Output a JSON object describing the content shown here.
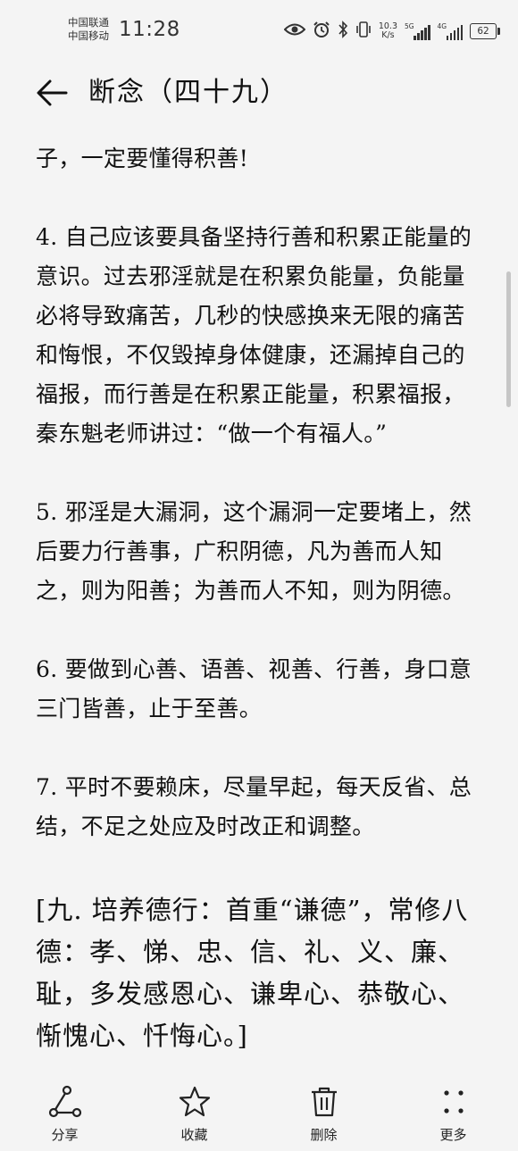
{
  "status_bar": {
    "carrier_1": "中国联通",
    "carrier_2": "中国移动",
    "time": "11:28",
    "net_speed_value": "10.3",
    "net_speed_unit": "K/s",
    "signal_1_label": "5G",
    "signal_2_label": "4G",
    "battery": "62"
  },
  "header": {
    "title": "断念（四十九）",
    "back_icon": "arrow-left-icon"
  },
  "article": {
    "p0": "子，一定要懂得积善!",
    "p4": "4. 自己应该要具备坚持行善和积累正能量的意识。过去邪淫就是在积累负能量，负能量必将导致痛苦，几秒的快感换来无限的痛苦和悔恨，不仅毁掉身体健康，还漏掉自己的福报，而行善是在积累正能量，积累福报，秦东魁老师讲过：“做一个有福人。”",
    "p5": "5. 邪淫是大漏洞，这个漏洞一定要堵上，然后要力行善事，广积阴德，凡为善而人知之，则为阳善；为善而人不知，则为阴德。",
    "p6": "6. 要做到心善、语善、视善、行善，身口意三门皆善，止于至善。",
    "p7": "7. 平时不要赖床，尽量早起，每天反省、总结，不足之处应及时改正和调整。",
    "p9": "[九. 培养德行：首重“谦德”，常修八德：孝、悌、忠、信、礼、义、廉、耻，多发感恩心、谦卑心、恭敬心、惭愧心、忏悔心。]"
  },
  "bottom_bar": {
    "share": "分享",
    "favorite": "收藏",
    "delete": "删除",
    "more": "更多"
  },
  "colors": {
    "background": "#f4f4f4",
    "text": "#111111",
    "scrollbar": "#c6c6c6"
  }
}
